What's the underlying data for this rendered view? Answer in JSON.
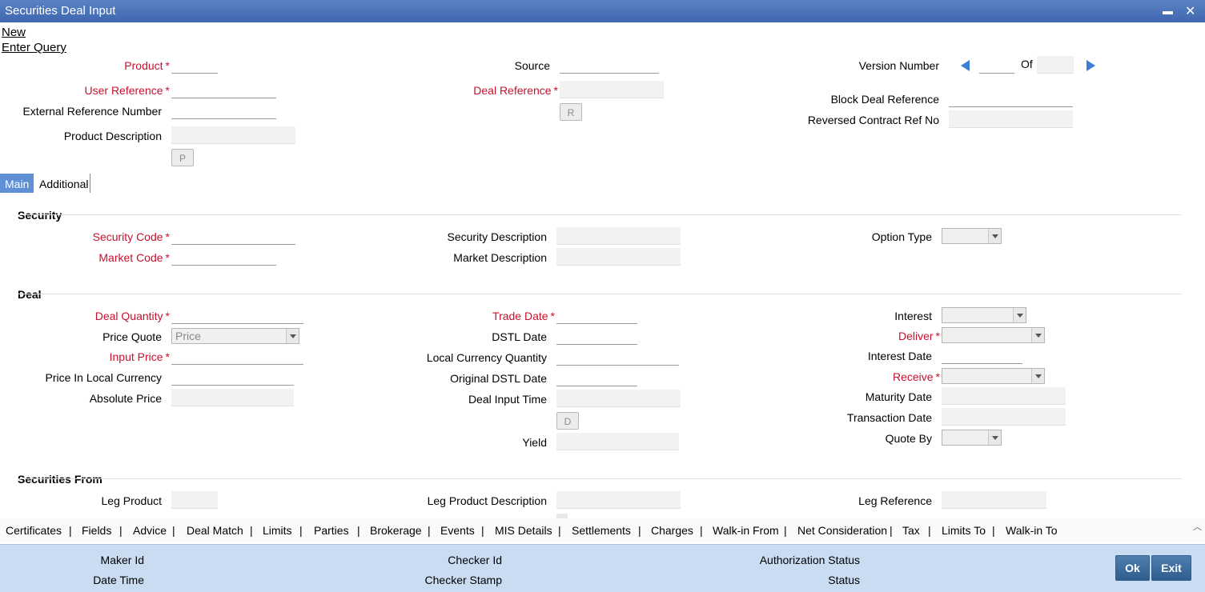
{
  "window": {
    "title": "Securities Deal Input",
    "minimize": "▬",
    "close": "✕"
  },
  "menu": {
    "new": "New",
    "enter_query": "Enter Query"
  },
  "header": {
    "product": "Product",
    "source": "Source",
    "version_number": "Version Number",
    "of": "Of",
    "user_reference": "User Reference",
    "deal_reference": "Deal Reference",
    "external_reference_number": "External Reference Number",
    "block_deal_reference": "Block Deal Reference",
    "reversed_contract_ref_no": "Reversed Contract Ref No",
    "product_description": "Product Description",
    "btn_r": "R",
    "btn_p": "P"
  },
  "tabs": {
    "main": "Main",
    "additional": "Additional"
  },
  "security": {
    "title": "Security",
    "security_code": "Security Code",
    "market_code": "Market Code",
    "security_description": "Security Description",
    "market_description": "Market Description",
    "option_type": "Option Type"
  },
  "deal": {
    "title": "Deal",
    "deal_quantity": "Deal Quantity",
    "price_quote": "Price Quote",
    "price_quote_value": "Price",
    "input_price": "Input Price",
    "price_in_local_currency": "Price In Local Currency",
    "absolute_price": "Absolute Price",
    "trade_date": "Trade Date",
    "dstl_date": "DSTL Date",
    "local_currency_quantity": "Local Currency Quantity",
    "original_dstl_date": "Original DSTL Date",
    "deal_input_time": "Deal Input Time",
    "btn_d": "D",
    "yield": "Yield",
    "interest": "Interest",
    "deliver": "Deliver",
    "interest_date": "Interest Date",
    "receive": "Receive",
    "maturity_date": "Maturity Date",
    "transaction_date": "Transaction Date",
    "quote_by": "Quote By"
  },
  "securities_from": {
    "title": "Securities From",
    "leg_product": "Leg Product",
    "leg_product_description": "Leg Product Description",
    "leg_reference": "Leg Reference"
  },
  "subsystems": [
    "Certificates",
    "Fields",
    "Advice",
    "Deal Match",
    "Limits",
    "Parties",
    "Brokerage",
    "Events",
    "MIS Details",
    "Settlements",
    "Charges",
    "Walk-in From",
    "Net Consideration",
    "Tax",
    "Limits To",
    "Walk-in To"
  ],
  "footer": {
    "maker_id": "Maker Id",
    "date_time": "Date Time",
    "checker_id": "Checker Id",
    "checker_stamp": "Checker Stamp",
    "authorization_status": "Authorization Status",
    "status": "Status",
    "ok": "Ok",
    "exit": "Exit"
  },
  "colors": {
    "title_bar": "#4a72b8",
    "required": "#c8102e",
    "footer": "#c9dcf1",
    "tab_active": "#5f8fd6"
  }
}
